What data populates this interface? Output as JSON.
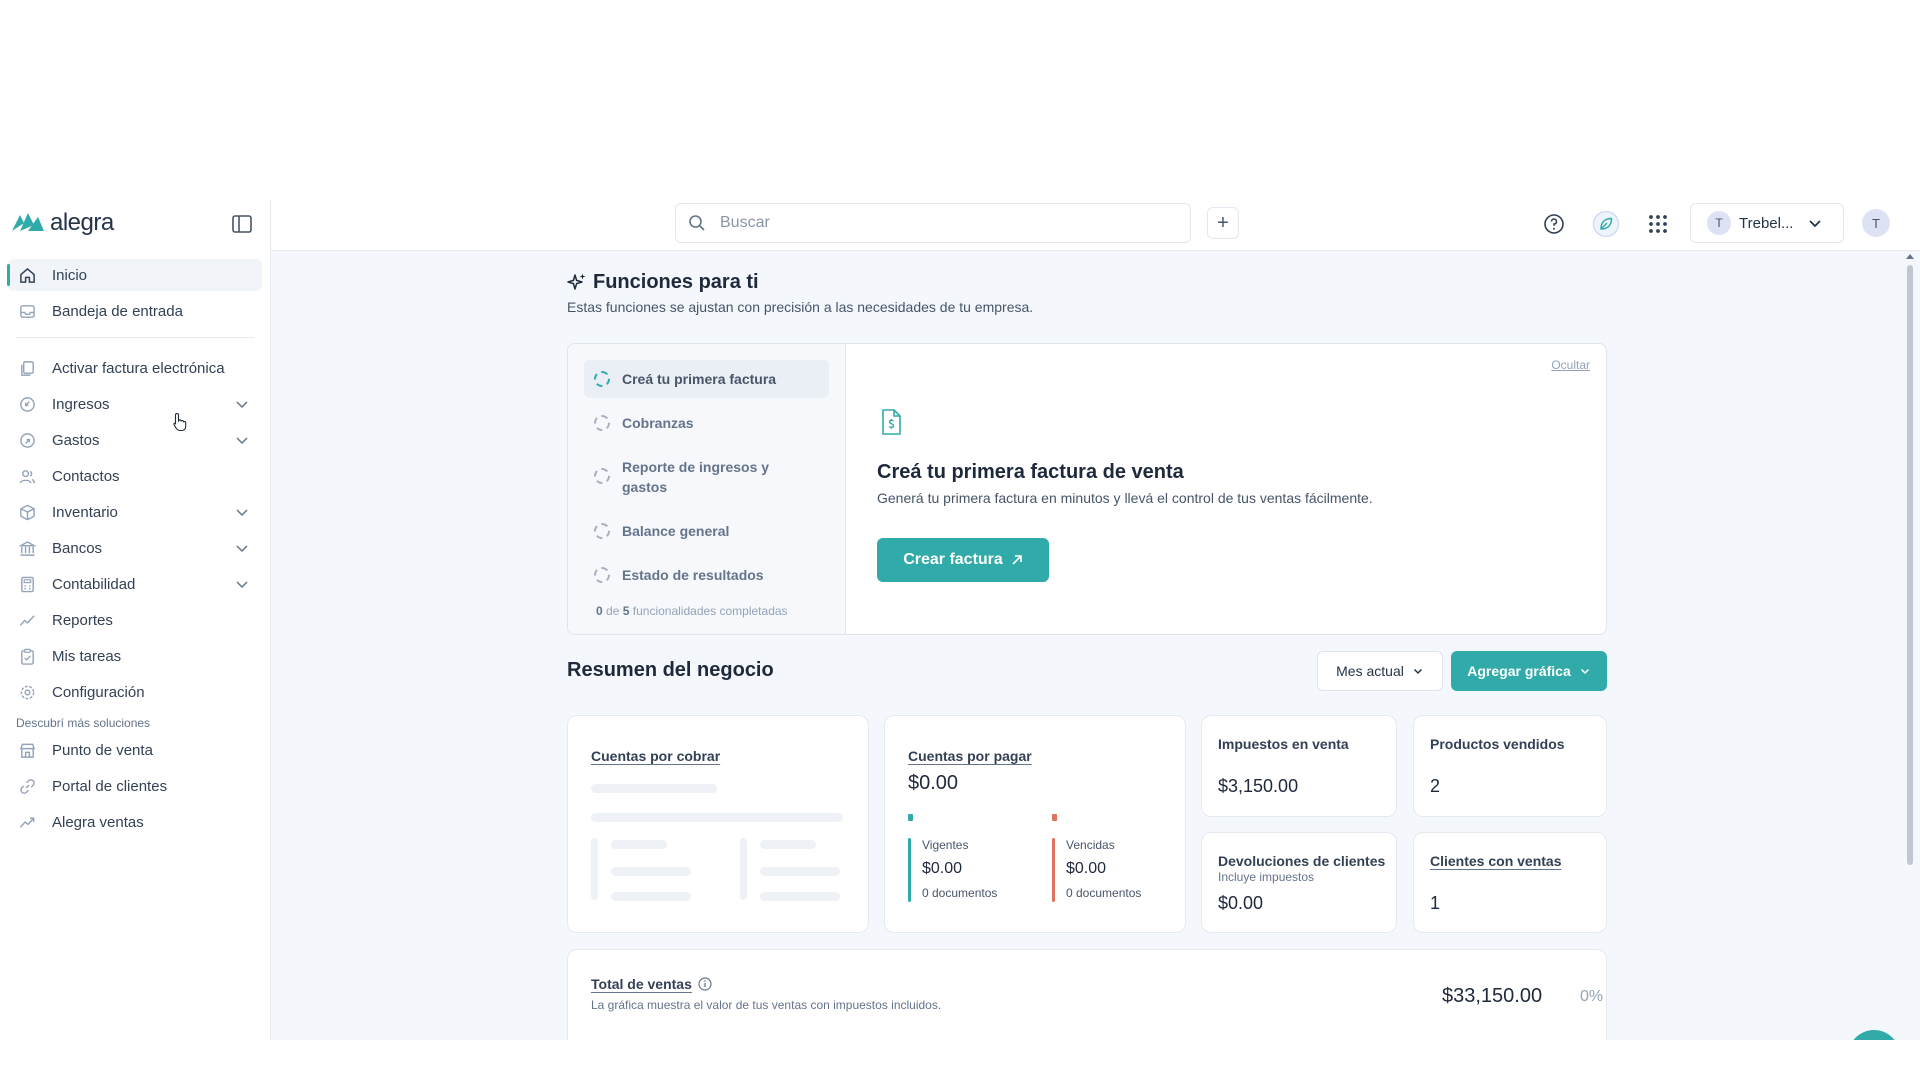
{
  "brand": {
    "name": "alegra",
    "accent": "#30aba9"
  },
  "sidebar": {
    "items": [
      {
        "label": "Inicio",
        "icon": "home-icon",
        "active": true
      },
      {
        "label": "Bandeja de entrada",
        "icon": "inbox-icon"
      },
      {
        "label": "Activar factura electrónica",
        "icon": "copy-icon"
      },
      {
        "label": "Ingresos",
        "icon": "income-icon",
        "expandable": true
      },
      {
        "label": "Gastos",
        "icon": "expense-icon",
        "expandable": true
      },
      {
        "label": "Contactos",
        "icon": "contacts-icon"
      },
      {
        "label": "Inventario",
        "icon": "box-icon",
        "expandable": true
      },
      {
        "label": "Bancos",
        "icon": "bank-icon",
        "expandable": true
      },
      {
        "label": "Contabilidad",
        "icon": "calculator-icon",
        "expandable": true
      },
      {
        "label": "Reportes",
        "icon": "chart-line-icon"
      },
      {
        "label": "Mis tareas",
        "icon": "clipboard-icon"
      },
      {
        "label": "Configuración",
        "icon": "gear-icon"
      }
    ],
    "section_title": "Descubrí más soluciones",
    "solutions": [
      {
        "label": "Punto de venta",
        "icon": "store-icon"
      },
      {
        "label": "Portal de clientes",
        "icon": "link-icon"
      },
      {
        "label": "Alegra ventas",
        "icon": "trend-icon"
      }
    ]
  },
  "header": {
    "search_placeholder": "Buscar",
    "add_label": "+",
    "company": "Trebel...",
    "company_initial": "T",
    "user_initial": "T"
  },
  "functions": {
    "title": "Funciones para ti",
    "subtitle": "Estas funciones se ajustan con precisión a las necesidades de tu empresa.",
    "hide_label": "Ocultar",
    "steps": [
      "Creá tu primera factura",
      "Cobranzas",
      "Reporte de ingresos y gastos",
      "Balance general",
      "Estado de resultados"
    ],
    "progress": {
      "done": "0",
      "total": "5",
      "suffix": "funcionalidades completadas",
      "of": "de"
    },
    "detail": {
      "title": "Creá tu primera factura de venta",
      "subtitle": "Generá tu primera factura en minutos y llevá el control de tus ventas fácilmente.",
      "button": "Crear factura"
    }
  },
  "summary": {
    "title": "Resumen del negocio",
    "period": "Mes actual",
    "add_chart": "Agregar gráfica",
    "receivable": {
      "label": "Cuentas por cobrar"
    },
    "payable": {
      "label": "Cuentas por pagar",
      "value": "$0.00",
      "current": {
        "label": "Vigentes",
        "value": "$0.00",
        "docs": "0 documentos",
        "color": "#30aba9"
      },
      "overdue": {
        "label": "Vencidas",
        "value": "$0.00",
        "docs": "0 documentos",
        "color": "#e0735f"
      }
    },
    "sales_tax": {
      "label": "Impuestos en venta",
      "value": "$3,150.00"
    },
    "products_sold": {
      "label": "Productos vendidos",
      "value": "2"
    },
    "returns": {
      "label": "Devoluciones de clientes",
      "note": "Incluye impuestos",
      "value": "$0.00"
    },
    "clients": {
      "label": "Clientes con ventas",
      "value": "1"
    },
    "total_sales": {
      "label": "Total de ventas",
      "note": "La gráfica muestra el valor de tus ventas con impuestos incluidos.",
      "value": "$33,150.00",
      "change": "0%"
    }
  }
}
